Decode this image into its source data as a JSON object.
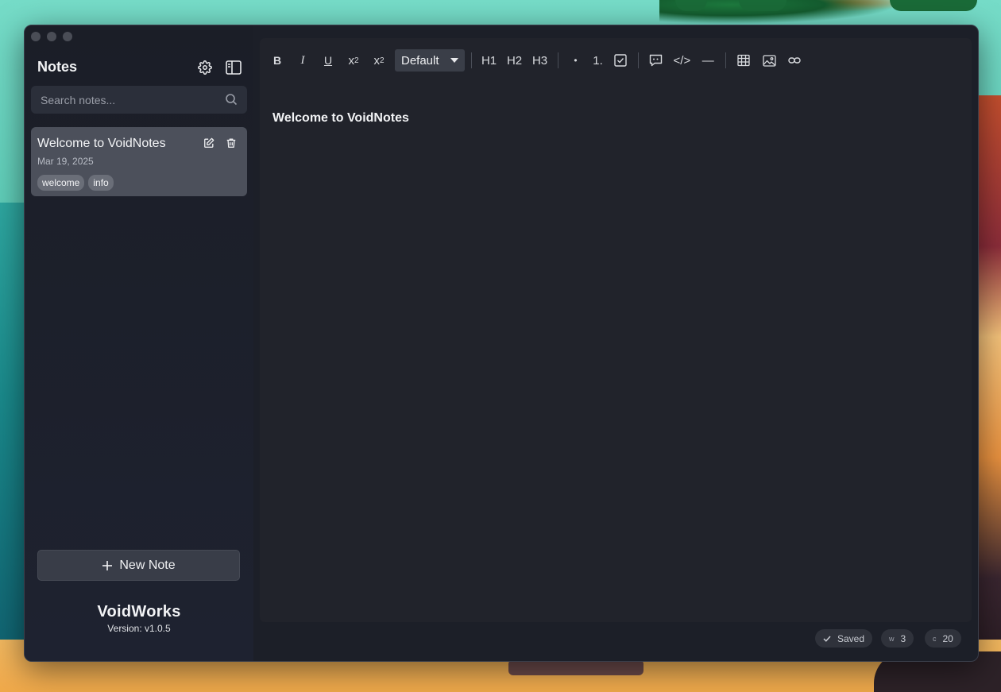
{
  "sidebar": {
    "title": "Notes",
    "search": {
      "placeholder": "Search notes...",
      "value": ""
    },
    "notes": [
      {
        "title": "Welcome to VoidNotes",
        "date": "Mar 19, 2025",
        "tags": [
          "welcome",
          "info"
        ]
      }
    ],
    "new_note_label": "New Note",
    "brand": "VoidWorks",
    "version": "Version: v1.0.5"
  },
  "toolbar": {
    "bold": "B",
    "italic": "I",
    "underline": "U",
    "superscript": {
      "base": "x",
      "mark": "2"
    },
    "subscript": {
      "base": "x",
      "mark": "2"
    },
    "style_select": "Default",
    "h1": "H1",
    "h2": "H2",
    "h3": "H3",
    "bullet": "•",
    "ordered": "1.",
    "code": "</>",
    "hr": "—"
  },
  "editor": {
    "content_title": "Welcome to VoidNotes"
  },
  "status": {
    "saved": "Saved",
    "words_key": "w",
    "words": "3",
    "chars_key": "c",
    "chars": "20"
  },
  "icons": {
    "settings": "gear-icon",
    "sidebar_toggle": "sidebar-toggle-icon",
    "search": "search-icon",
    "edit": "edit-icon",
    "delete": "trash-icon",
    "plus": "plus-icon",
    "task": "checkbox-icon",
    "quote": "quote-icon",
    "table": "table-icon",
    "image": "image-icon",
    "link": "link-icon",
    "check": "check-icon"
  },
  "colors": {
    "window_bg": "#1c1f28",
    "editor_bg": "#21232b",
    "card_bg": "#4c505b",
    "text": "#f2f3f5"
  }
}
